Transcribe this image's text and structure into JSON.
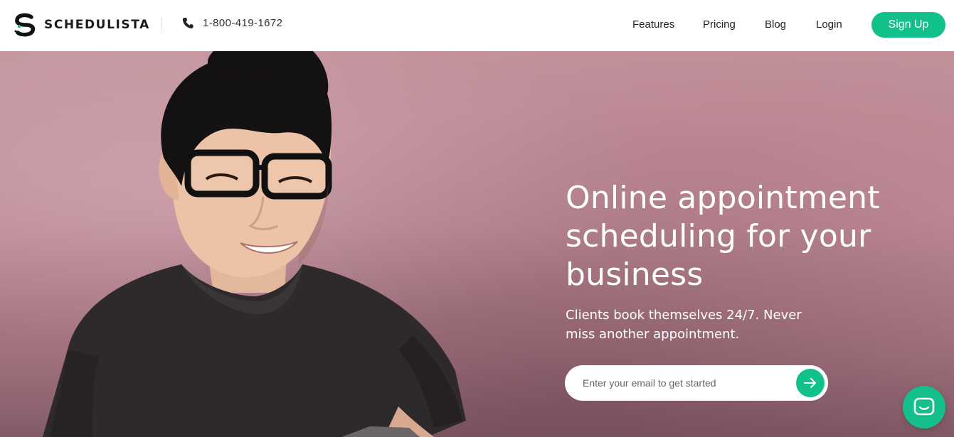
{
  "header": {
    "logo_text": "SCHEDULISTA",
    "phone": "1-800-419-1672",
    "nav": [
      {
        "label": "Features"
      },
      {
        "label": "Pricing"
      },
      {
        "label": "Blog"
      },
      {
        "label": "Login"
      }
    ],
    "signup_label": "Sign Up"
  },
  "hero": {
    "heading": "Online appointment scheduling for your business",
    "subheading": "Clients book themselves 24/7. Never miss another appointment.",
    "email_placeholder": "Enter your email to get started"
  },
  "icons": {
    "logo": "schedulista-logo-icon",
    "phone": "phone-icon",
    "submit": "arrow-right-icon",
    "chat": "chat-icon"
  },
  "colors": {
    "accent": "#11c08b",
    "hero_background": "#c5969f",
    "text_dark": "#222222"
  }
}
